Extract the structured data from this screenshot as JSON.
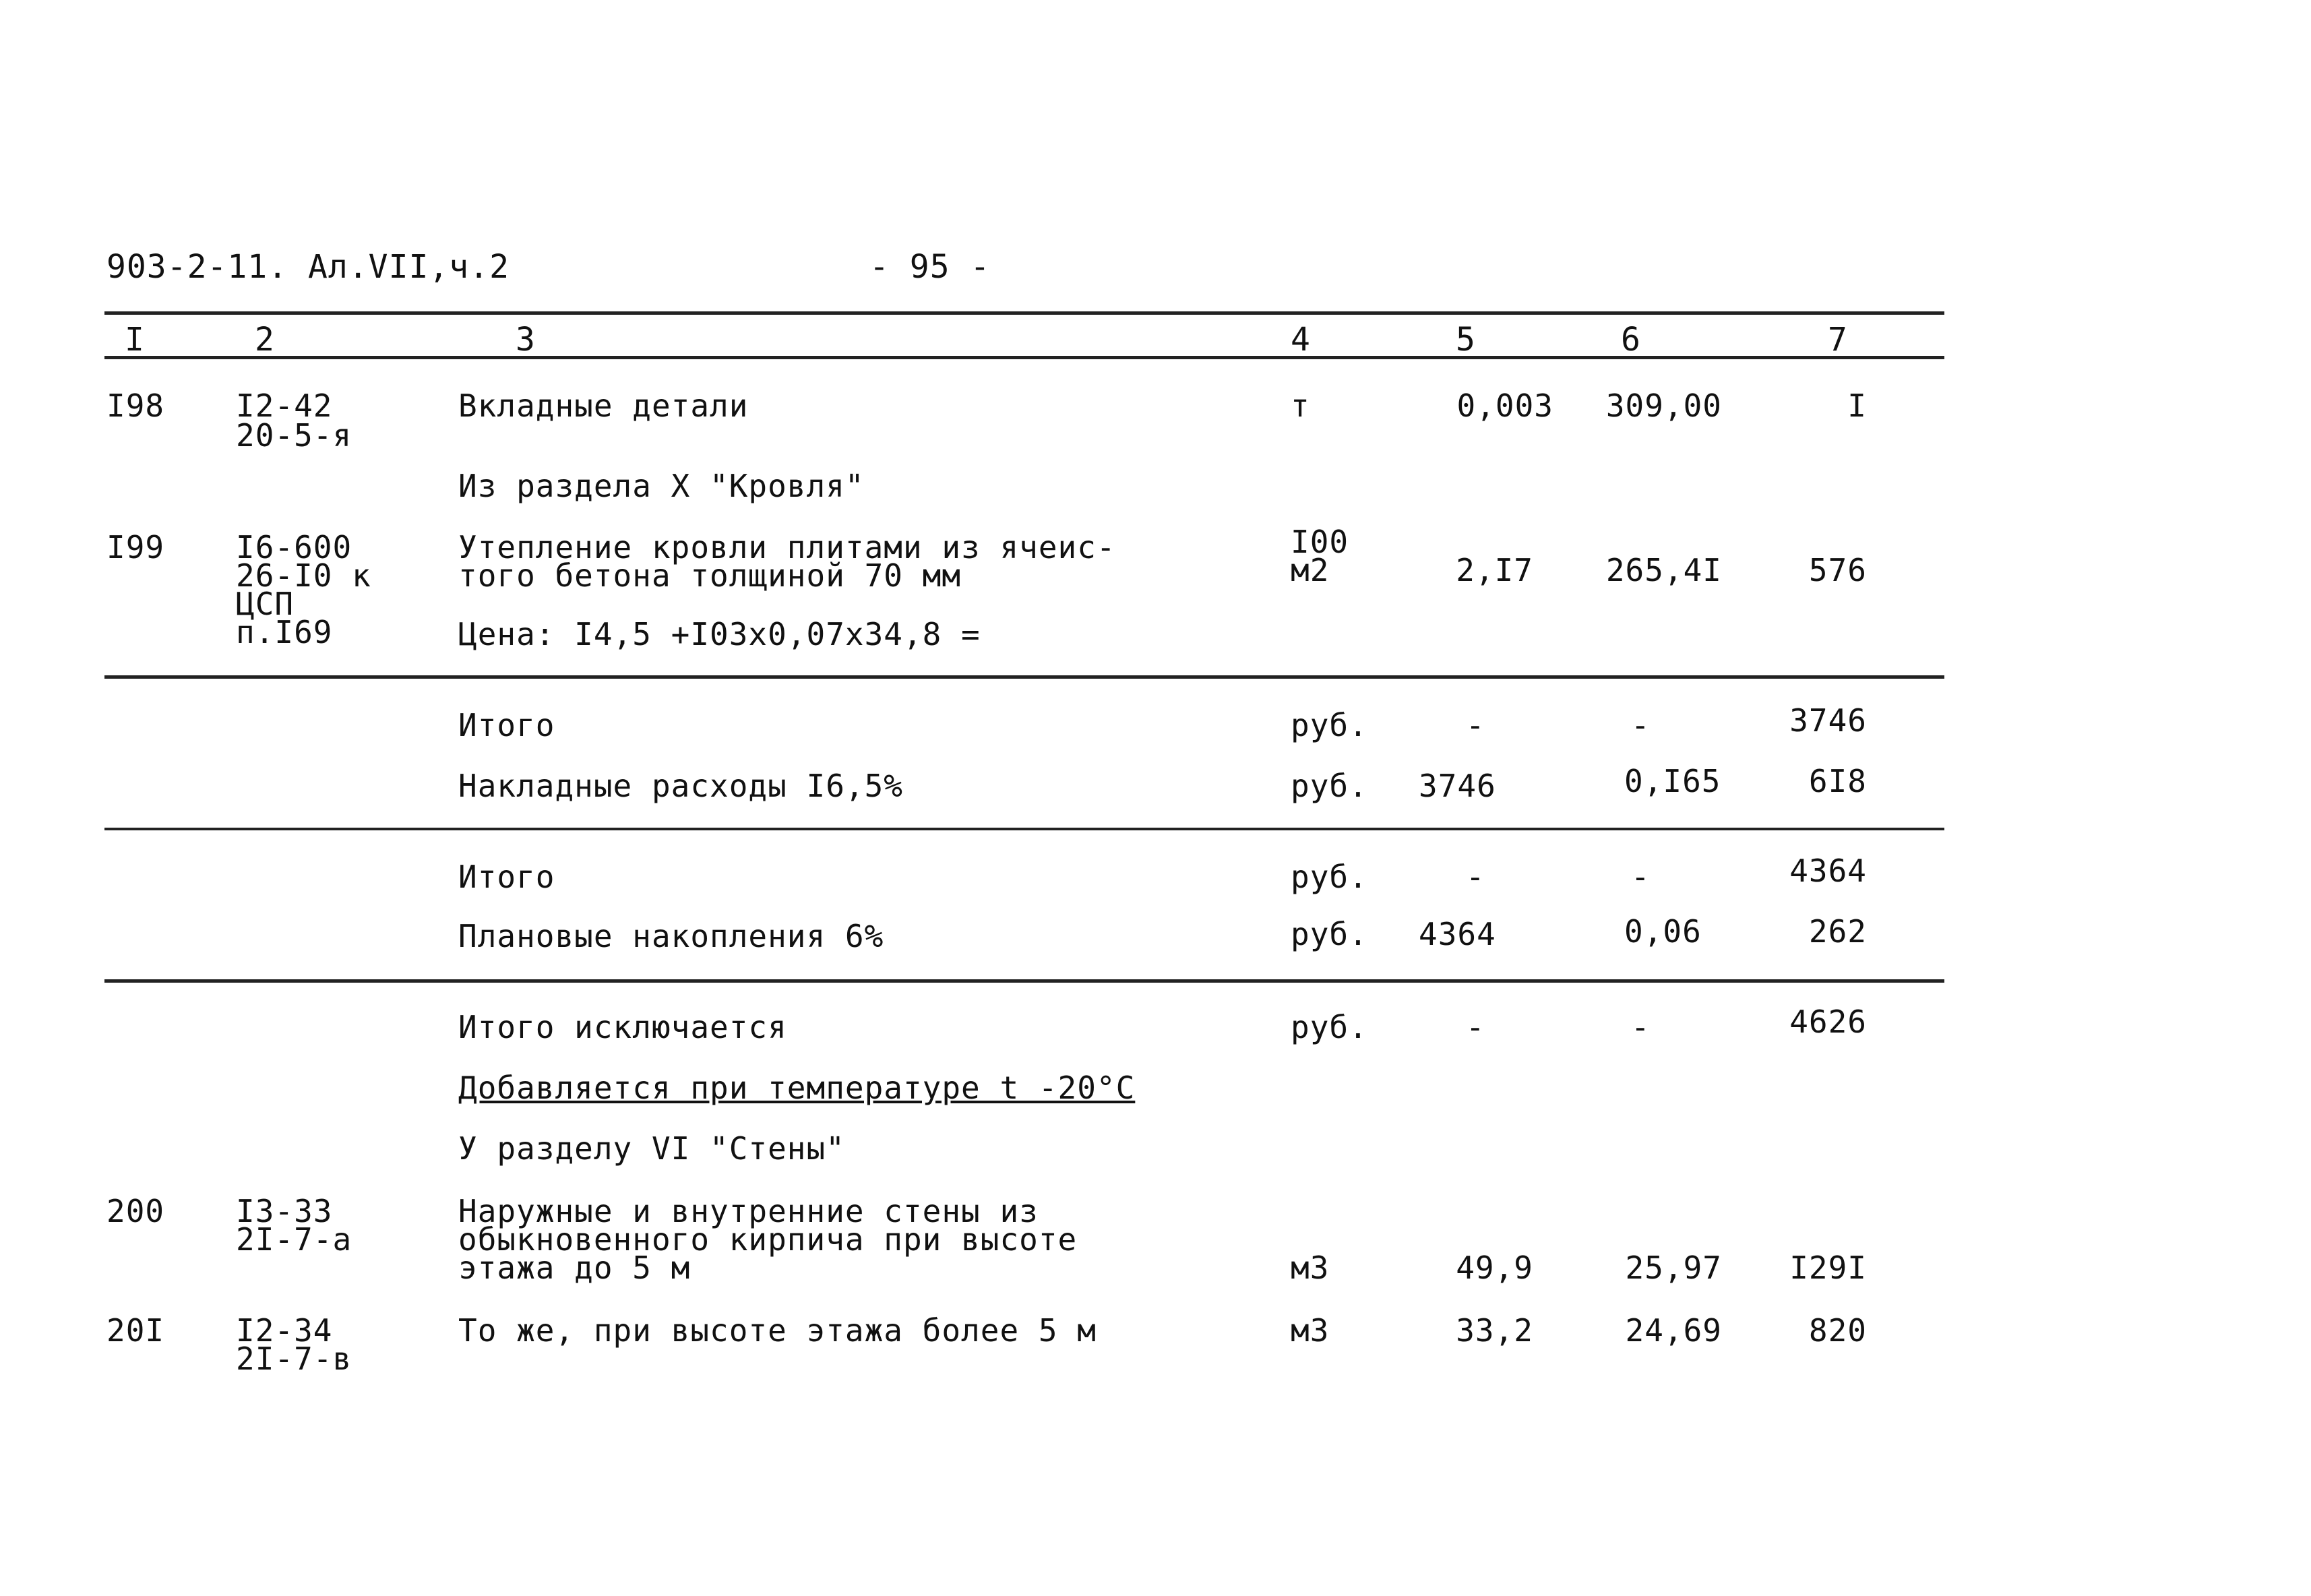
{
  "header": {
    "doc_code": "903-2-11. Ал.VII,ч.2",
    "page": "- 95 -"
  },
  "columns": [
    "I",
    "2",
    "3",
    "4",
    "5",
    "6",
    "7"
  ],
  "rows": [
    {
      "n": "I98",
      "code": [
        "I2-42",
        "20-5-я"
      ],
      "text": [
        "Вкладные детали"
      ],
      "unit": [
        "т"
      ],
      "qty": "0,003",
      "price": "309,00",
      "sum": "I"
    },
    {
      "section": "Из раздела X \"Кровля\""
    },
    {
      "n": "I99",
      "code": [
        "I6-600",
        "26-I0 к",
        "ЦСП",
        "п.I69"
      ],
      "text": [
        "Утепление кровли плитами из ячеис-",
        "того бетона толщиной 70 мм"
      ],
      "unit": [
        "I00",
        "м2"
      ],
      "qty": "2,I7",
      "price": "265,4I",
      "sum": "576",
      "price_note": "Цена: I4,5 +I03х0,07х34,8 ="
    },
    {
      "label": "Итого",
      "unit": "руб.",
      "qty": "-",
      "price": "-",
      "sum": "3746"
    },
    {
      "label": "Накладные расходы I6,5%",
      "unit": "руб.",
      "qty": "3746",
      "price": "0,I65",
      "sum": "6I8"
    },
    {
      "label": "Итого",
      "unit": "руб.",
      "qty": "-",
      "price": "-",
      "sum": "4364"
    },
    {
      "label": "Плановые накопления 6%",
      "unit": "руб.",
      "qty": "4364",
      "price": "0,06",
      "sum": "262"
    },
    {
      "label": "Итого исключается",
      "unit": "руб.",
      "qty": "-",
      "price": "-",
      "sum": "4626"
    },
    {
      "section": "Добавляется при температуре t -20°С"
    },
    {
      "section": "У разделу VI \"Стены\""
    },
    {
      "n": "200",
      "code": [
        "I3-33",
        "2I-7-а"
      ],
      "text": [
        "Наружные и внутренние стены из",
        "обыкновенного кирпича при высоте",
        "этажа до 5 м"
      ],
      "unit": [
        "м3"
      ],
      "qty": "49,9",
      "price": "25,97",
      "sum": "I29I"
    },
    {
      "n": "20I",
      "code": [
        "I2-34",
        "2I-7-в"
      ],
      "text": [
        "То же, при высоте этажа более 5 м"
      ],
      "unit": [
        "м3"
      ],
      "qty": "33,2",
      "price": "24,69",
      "sum": "820"
    }
  ]
}
